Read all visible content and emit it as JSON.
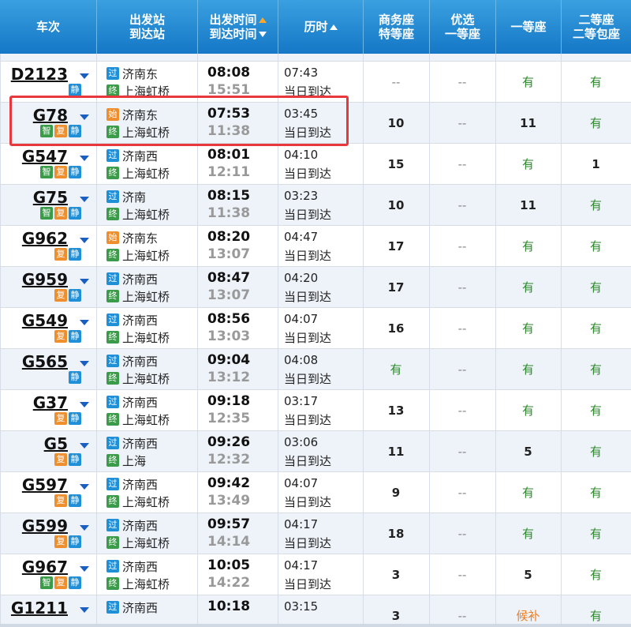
{
  "header": {
    "columns": [
      {
        "lines": [
          "车次"
        ]
      },
      {
        "lines": [
          "出发站",
          "到达站"
        ]
      },
      {
        "lines": [
          "出发时间",
          "到达时间"
        ]
      },
      {
        "lines": [
          "历时"
        ]
      },
      {
        "lines": [
          "商务座",
          "特等座"
        ]
      },
      {
        "lines": [
          "优选",
          "一等座"
        ]
      },
      {
        "lines": [
          "一等座"
        ]
      },
      {
        "lines": [
          "二等座",
          "二等包座"
        ]
      }
    ]
  },
  "badges": {
    "zhi": "智",
    "fu": "复",
    "jing": "静"
  },
  "station_icons": {
    "guo": "过",
    "shi": "始",
    "zhong": "终"
  },
  "colors": {
    "header_top": "#3aa0e0",
    "header_bottom": "#1577c6",
    "highlight": "#e8383d",
    "available": "#2a8a2a"
  },
  "trains": [
    {
      "no": "D2123",
      "badges": [
        "jing"
      ],
      "from_icon": "guo",
      "from": "济南东",
      "to": "上海虹桥",
      "dep": "08:08",
      "arr": "15:51",
      "duration": "07:43",
      "arrive_day": "当日到达",
      "seats": [
        "--",
        "--",
        "有",
        "有"
      ]
    },
    {
      "no": "G78",
      "badges": [
        "zhi",
        "fu",
        "jing"
      ],
      "from_icon": "shi",
      "from": "济南东",
      "to": "上海虹桥",
      "dep": "07:53",
      "arr": "11:38",
      "duration": "03:45",
      "arrive_day": "当日到达",
      "seats": [
        "10",
        "--",
        "11",
        "有"
      ]
    },
    {
      "no": "G547",
      "badges": [
        "zhi",
        "fu",
        "jing"
      ],
      "from_icon": "guo",
      "from": "济南西",
      "to": "上海虹桥",
      "dep": "08:01",
      "arr": "12:11",
      "duration": "04:10",
      "arrive_day": "当日到达",
      "seats": [
        "15",
        "--",
        "有",
        "1"
      ]
    },
    {
      "no": "G75",
      "badges": [
        "zhi",
        "fu",
        "jing"
      ],
      "from_icon": "guo",
      "from": "济南",
      "to": "上海虹桥",
      "dep": "08:15",
      "arr": "11:38",
      "duration": "03:23",
      "arrive_day": "当日到达",
      "seats": [
        "10",
        "--",
        "11",
        "有"
      ]
    },
    {
      "no": "G962",
      "badges": [
        "fu",
        "jing"
      ],
      "from_icon": "shi",
      "from": "济南东",
      "to": "上海虹桥",
      "dep": "08:20",
      "arr": "13:07",
      "duration": "04:47",
      "arrive_day": "当日到达",
      "seats": [
        "17",
        "--",
        "有",
        "有"
      ]
    },
    {
      "no": "G959",
      "badges": [
        "fu",
        "jing"
      ],
      "from_icon": "guo",
      "from": "济南西",
      "to": "上海虹桥",
      "dep": "08:47",
      "arr": "13:07",
      "duration": "04:20",
      "arrive_day": "当日到达",
      "seats": [
        "17",
        "--",
        "有",
        "有"
      ]
    },
    {
      "no": "G549",
      "badges": [
        "fu",
        "jing"
      ],
      "from_icon": "guo",
      "from": "济南西",
      "to": "上海虹桥",
      "dep": "08:56",
      "arr": "13:03",
      "duration": "04:07",
      "arrive_day": "当日到达",
      "seats": [
        "16",
        "--",
        "有",
        "有"
      ]
    },
    {
      "no": "G565",
      "badges": [
        "jing"
      ],
      "from_icon": "guo",
      "from": "济南西",
      "to": "上海虹桥",
      "dep": "09:04",
      "arr": "13:12",
      "duration": "04:08",
      "arrive_day": "当日到达",
      "seats": [
        "有",
        "--",
        "有",
        "有"
      ]
    },
    {
      "no": "G37",
      "badges": [
        "fu",
        "jing"
      ],
      "from_icon": "guo",
      "from": "济南西",
      "to": "上海虹桥",
      "dep": "09:18",
      "arr": "12:35",
      "duration": "03:17",
      "arrive_day": "当日到达",
      "seats": [
        "13",
        "--",
        "有",
        "有"
      ]
    },
    {
      "no": "G5",
      "badges": [
        "fu",
        "jing"
      ],
      "from_icon": "guo",
      "from": "济南西",
      "to": "上海",
      "dep": "09:26",
      "arr": "12:32",
      "duration": "03:06",
      "arrive_day": "当日到达",
      "seats": [
        "11",
        "--",
        "5",
        "有"
      ]
    },
    {
      "no": "G597",
      "badges": [
        "fu",
        "jing"
      ],
      "from_icon": "guo",
      "from": "济南西",
      "to": "上海虹桥",
      "dep": "09:42",
      "arr": "13:49",
      "duration": "04:07",
      "arrive_day": "当日到达",
      "seats": [
        "9",
        "--",
        "有",
        "有"
      ]
    },
    {
      "no": "G599",
      "badges": [
        "fu",
        "jing"
      ],
      "from_icon": "guo",
      "from": "济南西",
      "to": "上海虹桥",
      "dep": "09:57",
      "arr": "14:14",
      "duration": "04:17",
      "arrive_day": "当日到达",
      "seats": [
        "18",
        "--",
        "有",
        "有"
      ]
    },
    {
      "no": "G967",
      "badges": [
        "zhi",
        "fu",
        "jing"
      ],
      "from_icon": "guo",
      "from": "济南西",
      "to": "上海虹桥",
      "dep": "10:05",
      "arr": "14:22",
      "duration": "04:17",
      "arrive_day": "当日到达",
      "seats": [
        "3",
        "--",
        "5",
        "有"
      ]
    },
    {
      "no": "G1211",
      "badges": [],
      "from_icon": "guo",
      "from": "济南西",
      "to": "",
      "dep": "10:18",
      "arr": "",
      "duration": "03:15",
      "arrive_day": "",
      "seats": [
        "3",
        "--",
        "候补",
        "有"
      ]
    }
  ]
}
